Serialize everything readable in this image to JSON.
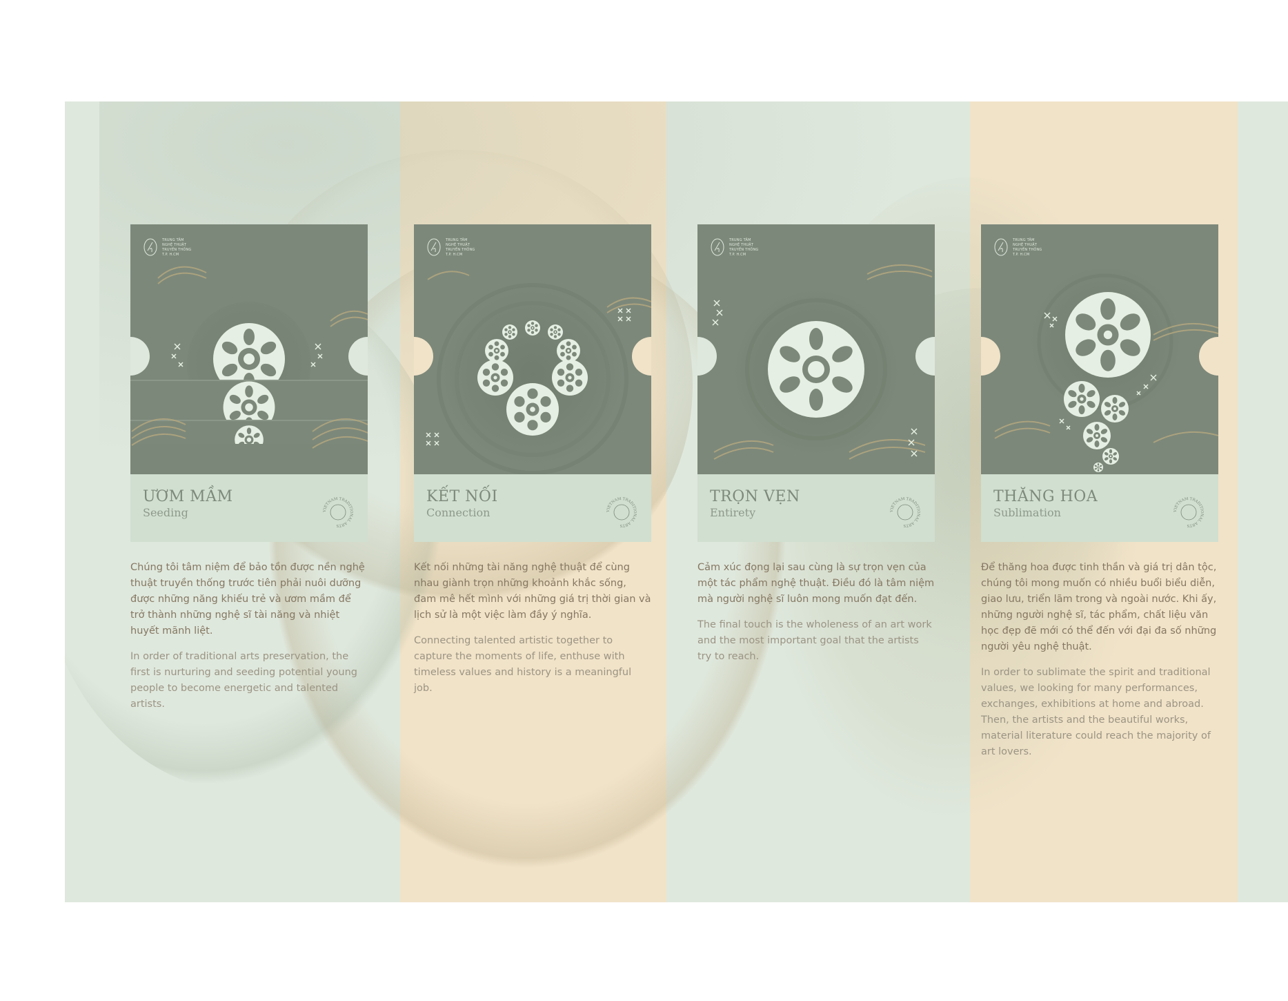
{
  "logo": {
    "lines": [
      "TRUNG TÂM",
      "NGHỆ THUẬT",
      "TRUYỀN THỐNG",
      "T.P. H.CM"
    ]
  },
  "seal_text": "VIETNAM TRADITIONAL ARTS",
  "colors": {
    "poster": "#7c887a",
    "label": "#d0dfd0",
    "green_stripe": "#dfe8dd",
    "beige_stripe": "#f1e3c8",
    "ornament": "#e6efe3",
    "wave": "#b7a97f"
  },
  "cards": [
    {
      "title": "ƯƠM MẦM",
      "subtitle": "Seeding",
      "text_vi": "Chúng tôi tâm niệm để bảo tồn được nền nghệ thuật truyền thống trước tiên phải nuôi dưỡng được những năng khiếu trẻ và ươm mầm để trở thành những nghệ sĩ tài năng và nhiệt huyết mãnh liệt.",
      "text_en": "In order of traditional arts preservation, the first is nurturing and seeding potential young people to become energetic and talented artists."
    },
    {
      "title": "KẾT NỐI",
      "subtitle": "Connection",
      "text_vi": "Kết nối những tài năng nghệ thuật để cùng nhau giành trọn những khoảnh khắc sống, đam mê hết mình với những giá trị thời gian và lịch sử là một việc làm đầy ý nghĩa.",
      "text_en": "Connecting talented artistic together to capture the moments of life, enthuse with timeless values and history is a meaningful job."
    },
    {
      "title": "TRỌN VẸN",
      "subtitle": "Entirety",
      "text_vi": "Cảm xúc đọng lại sau cùng là sự trọn vẹn của một tác phẩm nghệ thuật. Điều đó là tâm niệm mà người nghệ sĩ luôn mong muốn đạt đến.",
      "text_en": "The final touch is the wholeness of an art work and the most important goal that the artists try to reach."
    },
    {
      "title": "THĂNG HOA",
      "subtitle": "Sublimation",
      "text_vi": "Để thăng hoa được tinh thần và giá trị dân tộc, chúng tôi mong muốn có nhiều buổi biểu diễn, giao lưu, triển lãm trong và ngoài nước. Khi ấy, những người nghệ sĩ, tác phẩm, chất liệu văn học đẹp đẽ mới có thể đến với đại đa số những người yêu nghệ thuật.",
      "text_en": "In order to sublimate the spirit and traditional values, we looking for many performances, exchanges, exhibitions at home and abroad. Then, the artists and the beautiful works, material literature could reach the majority of art lovers."
    }
  ]
}
